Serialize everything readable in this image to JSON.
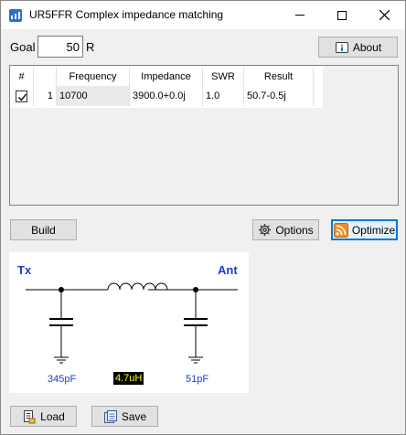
{
  "window": {
    "title": "UR5FFR Complex impedance matching",
    "controls": [
      "minimize",
      "maximize",
      "close"
    ]
  },
  "goal": {
    "label": "Goal",
    "value": "50",
    "unit": "R"
  },
  "buttons": {
    "about": "About",
    "build": "Build",
    "options": "Options",
    "optimize": "Optimize",
    "load": "Load",
    "save": "Save"
  },
  "table": {
    "columns": [
      "#",
      "Frequency",
      "Impedance",
      "SWR",
      "Result"
    ],
    "rows": [
      {
        "checked": true,
        "index": "1",
        "frequency": "10700",
        "impedance": "3900.0+0.0j",
        "swr": "1.0",
        "result": "50.7-0.5j"
      }
    ]
  },
  "schematic": {
    "input_label": "Tx",
    "output_label": "Ant",
    "c_in": "345pF",
    "inductor": "4.7uH",
    "c_out": "51pF"
  },
  "colors": {
    "label_blue": "#1c3bd1",
    "highlight_bg": "#000000",
    "highlight_fg": "#ffff00",
    "focus_blue": "#0078d7"
  },
  "icons": {
    "about": "about-icon",
    "options": "gear-icon",
    "optimize": "rss-icon",
    "load": "load-icon",
    "save": "save-icon"
  }
}
